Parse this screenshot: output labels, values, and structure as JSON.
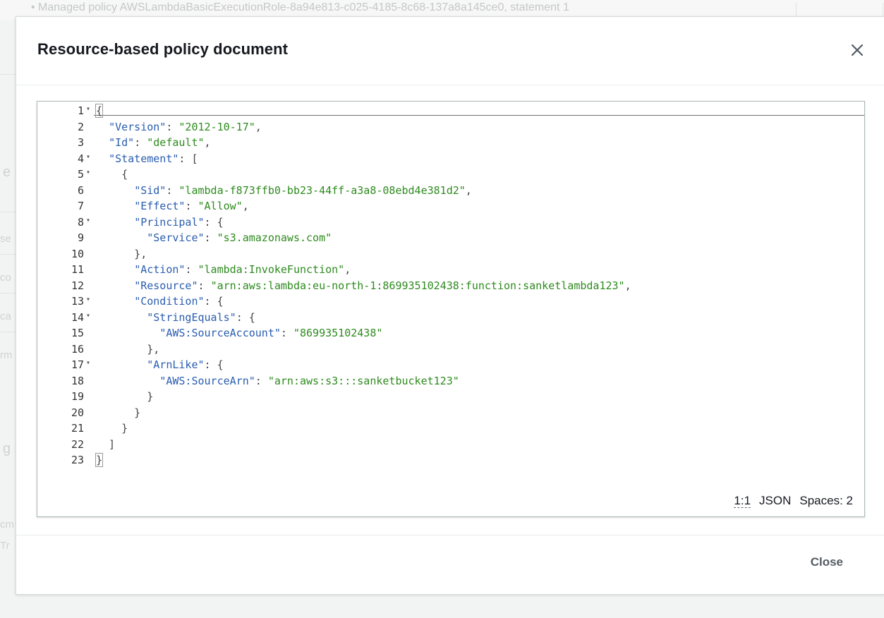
{
  "background": {
    "top_line": "• Managed policy AWSLambdaBasicExecutionRole-8a94e813-c025-4185-8c68-137a8a145ce0, statement 1",
    "fragments": [
      "e",
      "se",
      "co",
      "ca",
      "rm",
      "g",
      "cm",
      "Tr"
    ]
  },
  "modal": {
    "title": "Resource-based policy document",
    "close_icon": "close-icon",
    "footer_close_label": "Close"
  },
  "editor": {
    "lines": [
      {
        "n": "1",
        "fold": true,
        "code": "{"
      },
      {
        "n": "2",
        "fold": false,
        "code": "  \"Version\": \"2012-10-17\","
      },
      {
        "n": "3",
        "fold": false,
        "code": "  \"Id\": \"default\","
      },
      {
        "n": "4",
        "fold": true,
        "code": "  \"Statement\": ["
      },
      {
        "n": "5",
        "fold": true,
        "code": "    {"
      },
      {
        "n": "6",
        "fold": false,
        "code": "      \"Sid\": \"lambda-f873ffb0-bb23-44ff-a3a8-08ebd4e381d2\","
      },
      {
        "n": "7",
        "fold": false,
        "code": "      \"Effect\": \"Allow\","
      },
      {
        "n": "8",
        "fold": true,
        "code": "      \"Principal\": {"
      },
      {
        "n": "9",
        "fold": false,
        "code": "        \"Service\": \"s3.amazonaws.com\""
      },
      {
        "n": "10",
        "fold": false,
        "code": "      },"
      },
      {
        "n": "11",
        "fold": false,
        "code": "      \"Action\": \"lambda:InvokeFunction\","
      },
      {
        "n": "12",
        "fold": false,
        "code": "      \"Resource\": \"arn:aws:lambda:eu-north-1:869935102438:function:sanketlambda123\","
      },
      {
        "n": "13",
        "fold": true,
        "code": "      \"Condition\": {"
      },
      {
        "n": "14",
        "fold": true,
        "code": "        \"StringEquals\": {"
      },
      {
        "n": "15",
        "fold": false,
        "code": "          \"AWS:SourceAccount\": \"869935102438\""
      },
      {
        "n": "16",
        "fold": false,
        "code": "        },"
      },
      {
        "n": "17",
        "fold": true,
        "code": "        \"ArnLike\": {"
      },
      {
        "n": "18",
        "fold": false,
        "code": "          \"AWS:SourceArn\": \"arn:aws:s3:::sanketbucket123\""
      },
      {
        "n": "19",
        "fold": false,
        "code": "        }"
      },
      {
        "n": "20",
        "fold": false,
        "code": "      }"
      },
      {
        "n": "21",
        "fold": false,
        "code": "    }"
      },
      {
        "n": "22",
        "fold": false,
        "code": "  ]"
      },
      {
        "n": "23",
        "fold": false,
        "code": "}"
      }
    ],
    "status": {
      "cursor": "1:1",
      "mode": "JSON",
      "indent": "Spaces: 2"
    },
    "colors": {
      "key": "#2a5db0",
      "string": "#2e8b1e"
    }
  }
}
